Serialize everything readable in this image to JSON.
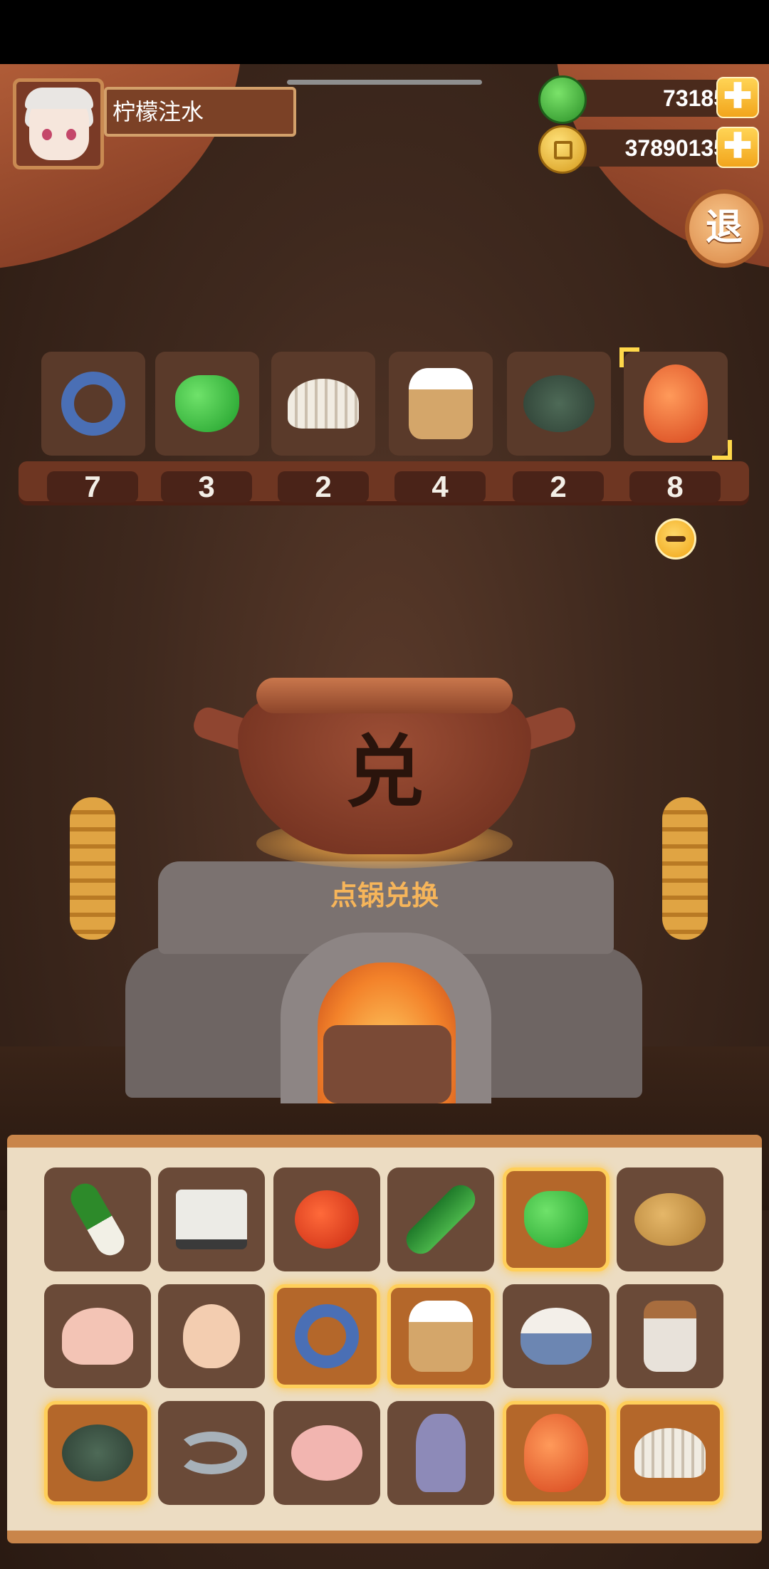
{
  "header": {
    "player_name": "柠檬注水",
    "gems": "73185",
    "coins": "37890135",
    "plus_symbol": "✚",
    "exit_label": "退"
  },
  "exchange_shelf": {
    "slots": [
      {
        "icon": "blue-fish-icon",
        "count": "7"
      },
      {
        "icon": "green-pepper-icon",
        "count": "3"
      },
      {
        "icon": "clam-icon",
        "count": "2"
      },
      {
        "icon": "flour-sack-icon",
        "count": "4"
      },
      {
        "icon": "crab-icon",
        "count": "2"
      },
      {
        "icon": "carp-icon",
        "count": "8",
        "selected": true
      }
    ]
  },
  "pot": {
    "glyph": "兑",
    "tap_label": "点锅兑换"
  },
  "inventory": {
    "rows": [
      [
        {
          "icon": "leek-icon",
          "active": false
        },
        {
          "icon": "tofu-icon",
          "active": false
        },
        {
          "icon": "tomato-icon",
          "active": false
        },
        {
          "icon": "cucumber-icon",
          "active": false
        },
        {
          "icon": "green-pepper-icon",
          "active": true
        },
        {
          "icon": "potato-icon",
          "active": false
        }
      ],
      [
        {
          "icon": "chicken-icon",
          "active": false
        },
        {
          "icon": "egg-icon",
          "active": false
        },
        {
          "icon": "blue-fish-icon",
          "active": true
        },
        {
          "icon": "flour-sack-icon",
          "active": true
        },
        {
          "icon": "rice-bowl-icon",
          "active": false
        },
        {
          "icon": "jar-icon",
          "active": false
        }
      ],
      [
        {
          "icon": "crab-icon",
          "active": true
        },
        {
          "icon": "shrimp-icon",
          "active": false
        },
        {
          "icon": "duck-icon",
          "active": false
        },
        {
          "icon": "squid-icon",
          "active": false
        },
        {
          "icon": "carp-icon",
          "active": true
        },
        {
          "icon": "clam-icon",
          "active": true
        }
      ]
    ]
  }
}
